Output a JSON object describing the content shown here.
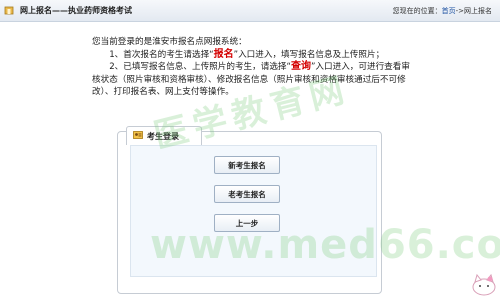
{
  "header": {
    "title": "网上报名——执业药师资格考试",
    "location_prefix": "您现在的位置：",
    "home_link": "首页",
    "location_suffix": "->网上报名"
  },
  "intro": {
    "line1": "您当前登录的是淮安市报名点网报系统：",
    "step1_pre": "1、首次报名的考生请选择“",
    "step1_kw": "报名",
    "step1_post": "”入口进入，填写报名信息及上传照片；",
    "step2_pre": "2、已填写报名信息、上传照片的考生，请选择“",
    "step2_kw": "查询",
    "step2_post": "”入口进入，可进行查看审核状态（照片审核和资格审核）、修改报名信息（照片审核和资格审核通过后不可修改）、打印报名表、网上支付等操作。"
  },
  "panel": {
    "title": "考生登录",
    "buttons": {
      "new": "新考生报名",
      "old": "老考生报名",
      "back": "上一步"
    }
  },
  "watermark": {
    "top": "医学教育网",
    "bottom": "www.med66.com"
  },
  "colors": {
    "keyword": "#d40000",
    "link": "#1a4fa0",
    "watermark": "#78c878"
  }
}
